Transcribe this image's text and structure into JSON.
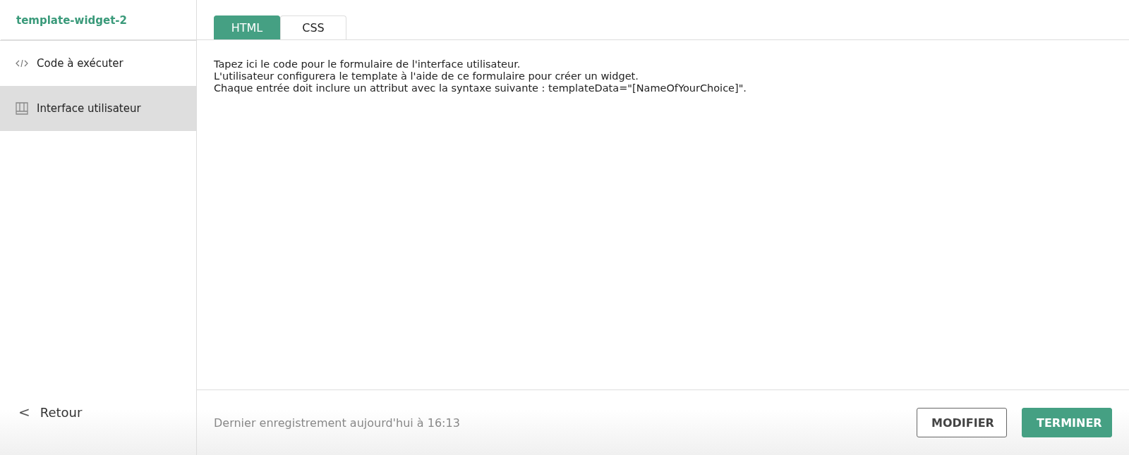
{
  "sidebar": {
    "title": "template-widget-2",
    "items": [
      {
        "label": "Code à exécuter",
        "kind": "code",
        "selected": false
      },
      {
        "label": "Interface utilisateur",
        "kind": "layout",
        "selected": true
      }
    ],
    "back": {
      "icon": "<",
      "label": "Retour"
    }
  },
  "tabs": [
    {
      "label": "HTML",
      "selected": true
    },
    {
      "label": "CSS",
      "selected": false
    }
  ],
  "editor": {
    "lines": [
      "Tapez ici le code pour le formulaire de l'interface utilisateur.",
      "L'utilisateur configurera le template à l'aide de ce formulaire pour créer un widget.",
      "Chaque entrée doit inclure un attribut avec la syntaxe suivante : templateData=\"[NameOfYourChoice]\"."
    ]
  },
  "footer": {
    "status": "Dernier enregistrement aujourd'hui à 16:13",
    "buttons": [
      {
        "label": "MODIFIER",
        "kind": "secondary"
      },
      {
        "label": "TERMINER",
        "kind": "primary"
      }
    ]
  }
}
